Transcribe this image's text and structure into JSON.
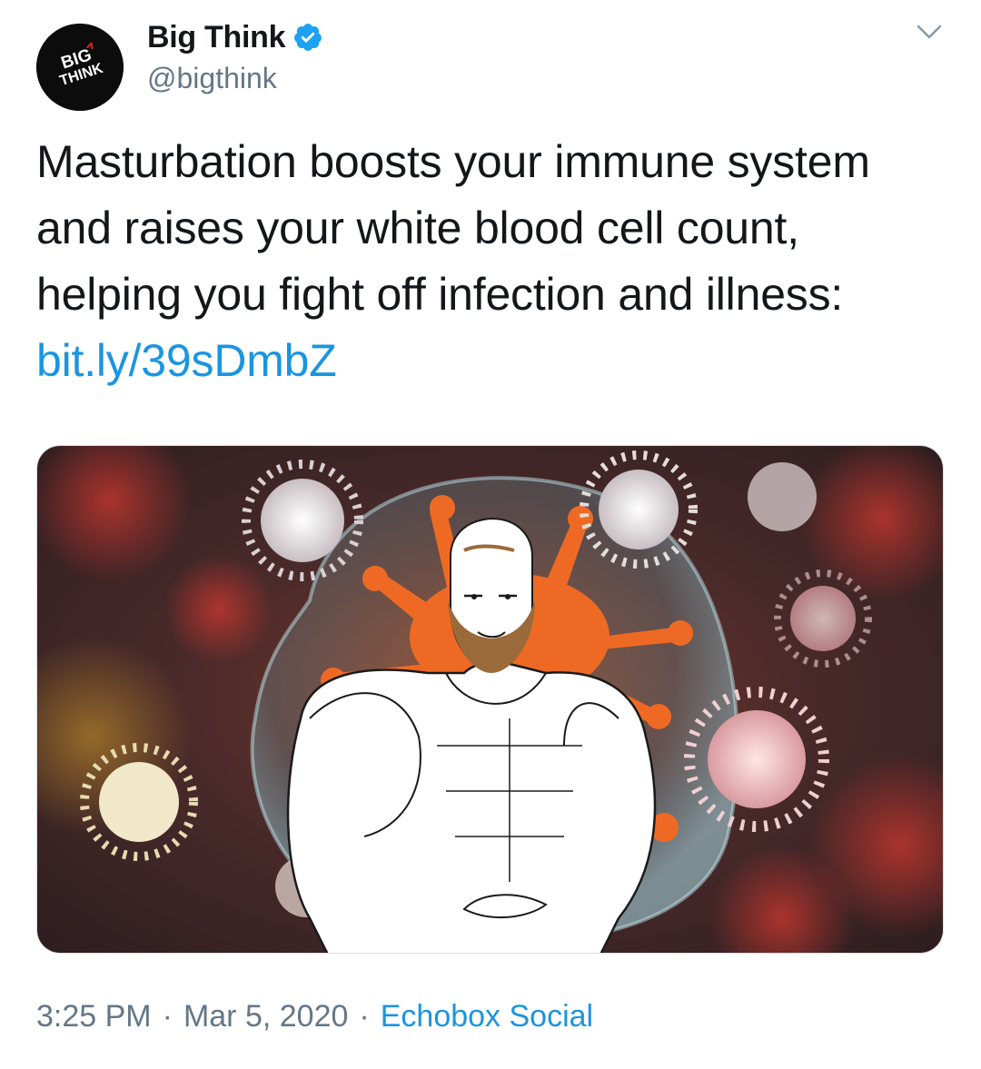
{
  "author": {
    "display_name": "Big Think",
    "handle": "@bigthink",
    "avatar_text_line1": "BIG",
    "avatar_text_line2": "THINK",
    "verified": true
  },
  "tweet": {
    "text": "Masturbation boosts your immune system and raises your white blood cell count, helping you fight off infection and illness: ",
    "link": "bit.ly/39sDmbZ"
  },
  "meta": {
    "time": "3:25 PM",
    "separator1": "·",
    "date": "Mar 5, 2020",
    "separator2": "·",
    "source": "Echobox Social"
  },
  "colors": {
    "link": "#1b95e0",
    "secondary_text": "#657786",
    "verified": "#1da1f2"
  },
  "icons": {
    "verified": "verified-badge-icon",
    "menu": "chevron-down-icon"
  }
}
